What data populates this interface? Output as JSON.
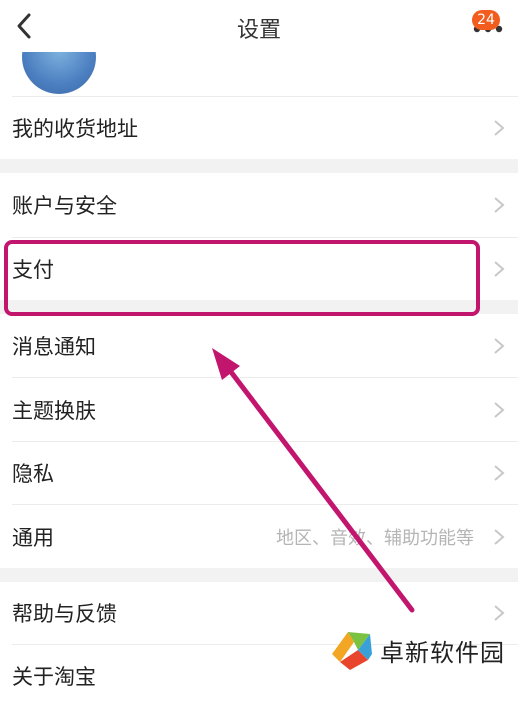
{
  "header": {
    "title": "设置",
    "badge_count": "24"
  },
  "menu": {
    "address": "我的收货地址",
    "account_security": "账户与安全",
    "payment": "支付",
    "notifications": "消息通知",
    "theme": "主题换肤",
    "privacy": "隐私",
    "general": "通用",
    "general_sub": "地区、音效、辅助功能等",
    "help_feedback": "帮助与反馈",
    "about": "关于淘宝"
  },
  "watermark": {
    "text": "卓新软件园"
  },
  "colors": {
    "highlight": "#c2166e",
    "badge": "#f25c1e",
    "section_gap": "#f2f2f2"
  }
}
